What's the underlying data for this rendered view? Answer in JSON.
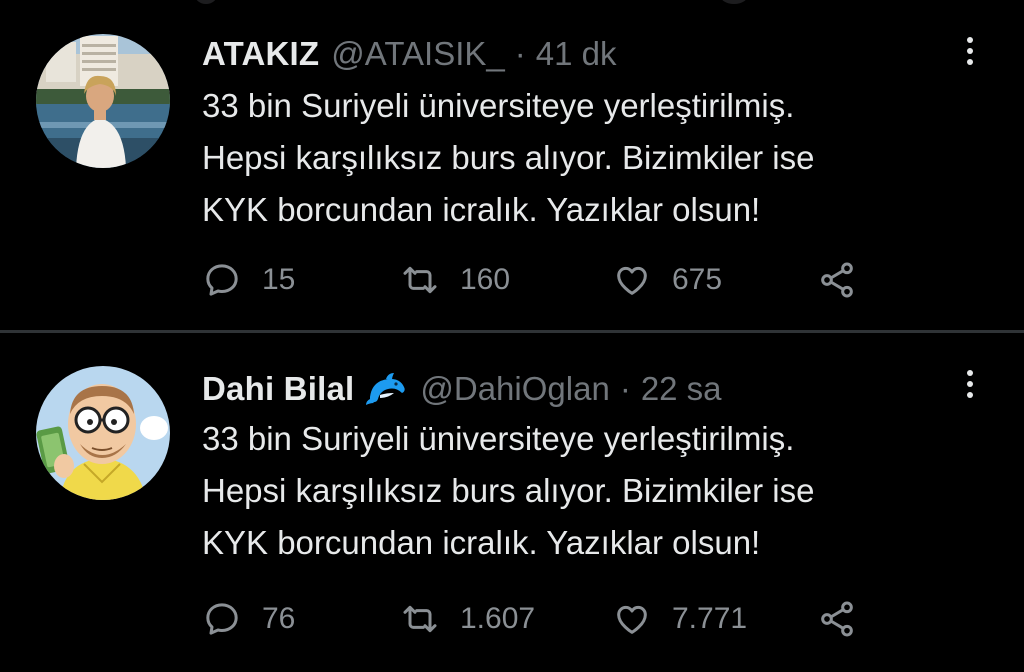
{
  "tweets": [
    {
      "name": "ATAKIZ",
      "handle": "@ATAISIK_",
      "separator": "·",
      "time": "41 dk",
      "avatar_icon": "woman-by-pool-avatar",
      "text_lines": [
        "33 bin Suriyeli üniversiteye yerleştirilmiş.",
        "Hepsi karşılıksız burs alıyor. Bizimkiler ise",
        "KYK borcundan icralık. Yazıklar olsun!"
      ],
      "replies": "15",
      "retweets": "160",
      "likes": "675"
    },
    {
      "name": "Dahi Bilal",
      "badge_icon": "dolphin-emoji",
      "handle": "@DahiOglan",
      "separator": "·",
      "time": "22 sa",
      "avatar_icon": "cartoon-man-avatar",
      "text_lines": [
        "33 bin Suriyeli üniversiteye yerleştirilmiş.",
        "Hepsi karşılıksız burs alıyor. Bizimkiler ise",
        "KYK borcundan icralık. Yazıklar olsun!"
      ],
      "replies": "76",
      "retweets": "1.607",
      "likes": "7.771"
    }
  ],
  "colors": {
    "background": "#000000",
    "text": "#e7e9ea",
    "muted": "#71767b",
    "divider": "#2f3336",
    "dolphin": "#1d9bf0"
  }
}
